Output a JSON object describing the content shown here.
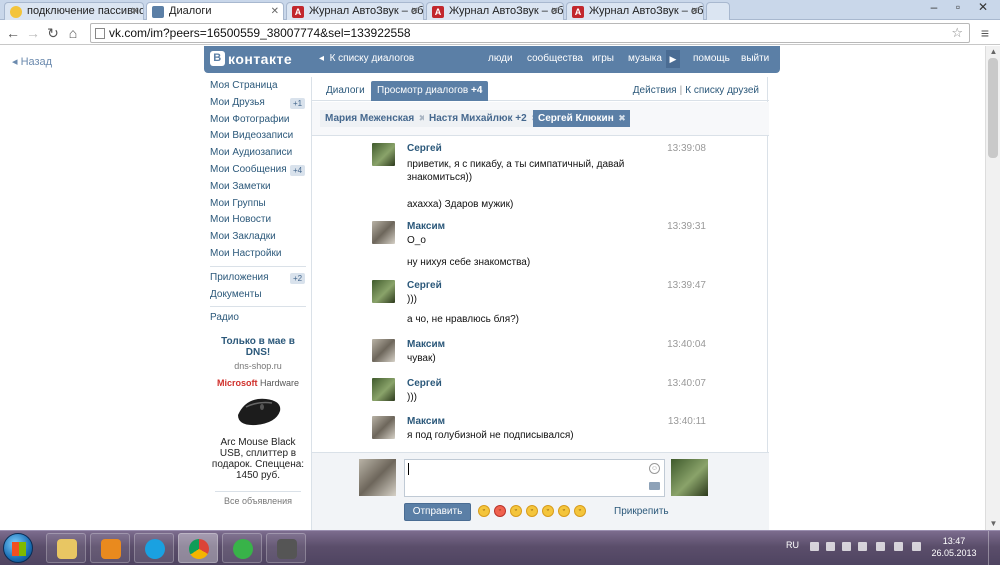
{
  "browser": {
    "tabs": [
      {
        "title": "подключение пассивно",
        "icon": "yellow-face-icon",
        "active": false
      },
      {
        "title": "Диалоги",
        "icon": "vk-icon",
        "active": true
      },
      {
        "title": "Журнал АвтоЗвук – обзо",
        "icon": "journal-icon",
        "active": false
      },
      {
        "title": "Журнал АвтоЗвук – обзо",
        "icon": "journal-icon",
        "active": false
      },
      {
        "title": "Журнал АвтоЗвук – обзо",
        "icon": "journal-icon",
        "active": false
      }
    ],
    "url": "vk.com/im?peers=16500559_38007774&sel=133922558"
  },
  "page": {
    "back_label": "Назад",
    "logo_text": "контакте",
    "logo_letter": "В",
    "header_back": "К списку диалогов",
    "nav": [
      "люди",
      "сообщества",
      "игры",
      "музыка",
      "помощь",
      "выйти"
    ]
  },
  "leftmenu": {
    "items": [
      {
        "label": "Моя Страница",
        "badge": ""
      },
      {
        "label": "Мои Друзья",
        "badge": "+1"
      },
      {
        "label": "Мои Фотографии",
        "badge": ""
      },
      {
        "label": "Мои Видеозаписи",
        "badge": ""
      },
      {
        "label": "Мои Аудиозаписи",
        "badge": ""
      },
      {
        "label": "Мои Сообщения",
        "badge": "+4"
      },
      {
        "label": "Мои Заметки",
        "badge": ""
      },
      {
        "label": "Мои Группы",
        "badge": ""
      },
      {
        "label": "Мои Новости",
        "badge": ""
      },
      {
        "label": "Мои Закладки",
        "badge": ""
      },
      {
        "label": "Мои Настройки",
        "badge": ""
      }
    ],
    "extra": [
      {
        "label": "Приложения",
        "badge": "+2"
      },
      {
        "label": "Документы",
        "badge": ""
      }
    ],
    "radio": "Радио"
  },
  "ad": {
    "title": "Только в мае в DNS!",
    "site": "dns-shop.ru",
    "brand": "Microsoft",
    "brand_suffix": "Hardware",
    "description": "Arc Mouse Black USB, сплиттер в подарок. Спеццена: 1450 руб.",
    "all_ads": "Все объявления"
  },
  "dialogs": {
    "tab_dialogs": "Диалоги",
    "tab_view": "Просмотр диалогов",
    "tab_view_count": "+4",
    "actions": "Действия",
    "to_friends": "К списку друзей",
    "chips": [
      {
        "name": "Мария Меженская",
        "selected": false
      },
      {
        "name": "Настя Михайлюк +2",
        "selected": false
      },
      {
        "name": "Сергей Клюкин",
        "selected": true
      }
    ]
  },
  "messages": [
    {
      "author": "Сергей",
      "time": "13:39:08",
      "avatar": "sergey",
      "lines": [
        "приветик, я с пикабу, а ты симпатичный, давай знакомиться))",
        "ахахха) Здаров мужик)"
      ]
    },
    {
      "author": "Максим",
      "time": "13:39:31",
      "avatar": "maxim",
      "lines": [
        "О_о",
        "ну нихуя себе знакомства)"
      ]
    },
    {
      "author": "Сергей",
      "time": "13:39:47",
      "avatar": "sergey",
      "lines": [
        ")))",
        "а чо, не нравлюсь бля?)"
      ]
    },
    {
      "author": "Максим",
      "time": "13:40:04",
      "avatar": "maxim",
      "lines": [
        "чувак)"
      ]
    },
    {
      "author": "Сергей",
      "time": "13:40:07",
      "avatar": "sergey",
      "lines": [
        ")))"
      ]
    },
    {
      "author": "Максим",
      "time": "13:40:11",
      "avatar": "maxim",
      "lines": [
        "я под голубизной не подписывался)"
      ]
    }
  ],
  "composer": {
    "input_value": "",
    "send_label": "Отправить",
    "attach_label": "Прикрепить"
  },
  "taskbar": {
    "lang": "RU",
    "time": "13:47",
    "date": "26.05.2013"
  },
  "colors": {
    "vk_blue": "#5b7fa6",
    "link": "#2b587a"
  }
}
